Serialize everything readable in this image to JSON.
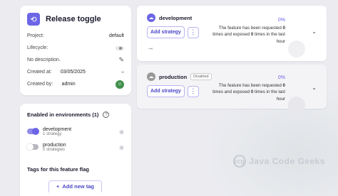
{
  "overview": {
    "title": "Release toggle",
    "rows": [
      {
        "label": "Project:",
        "value": "default"
      },
      {
        "label": "Lifecycle:",
        "value": ""
      },
      {
        "label": "No description.",
        "value": ""
      },
      {
        "label": "Created at:",
        "value": "03/05/2025"
      },
      {
        "label": "Created by:",
        "value": "admin"
      }
    ]
  },
  "environments": {
    "heading": "Enabled in environments (1)",
    "items": [
      {
        "name": "development",
        "sub": "1 strategy",
        "enabled": true
      },
      {
        "name": "production",
        "sub": "0 strategies",
        "enabled": false
      }
    ]
  },
  "tags": {
    "heading": "Tags for this feature flag",
    "add_label": "Add new tag"
  },
  "env_panels": {
    "development": {
      "name": "development",
      "add_strategy": "Add strategy",
      "percent": "0%",
      "metric_pre": "The feature has been requested ",
      "requested": "0",
      "metric_mid": " times and exposed ",
      "exposed": "0",
      "metric_post": " times in the last hour"
    },
    "production": {
      "name": "production",
      "badge": "Disabled",
      "add_strategy": "Add strategy",
      "percent": "0%",
      "metric_pre": "The feature has been requested ",
      "requested": "0",
      "metric_mid": " times and exposed ",
      "exposed": "0",
      "metric_post": " times in the last hour"
    }
  },
  "watermark": "Java Code Geeks",
  "colors": {
    "accent": "#6c65e5",
    "background": "#ebebf0"
  }
}
